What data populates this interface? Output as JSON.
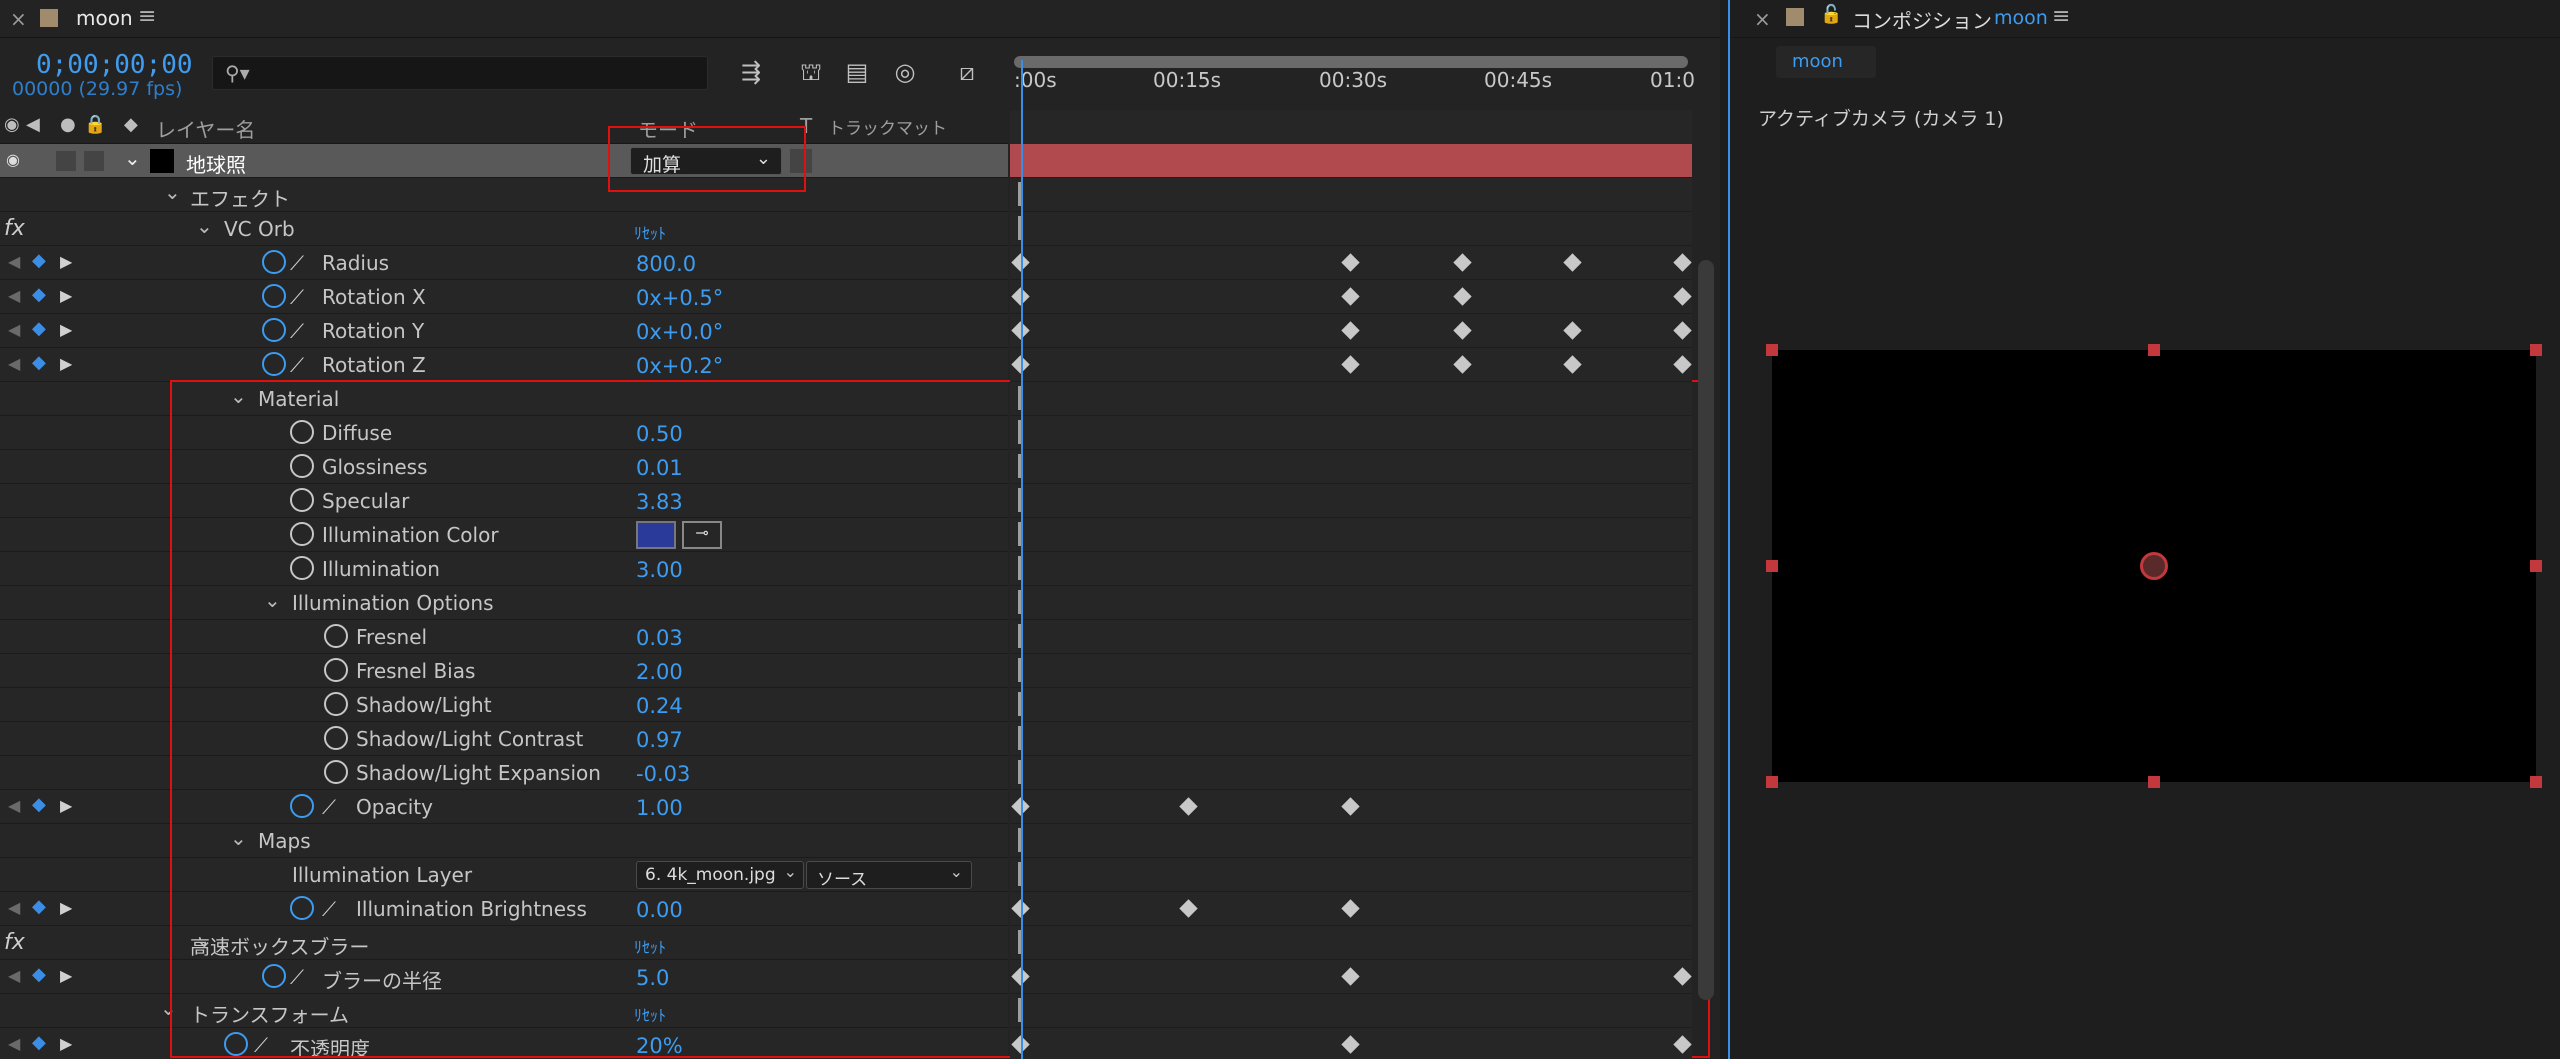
{
  "timeline": {
    "tab_title": "moon",
    "timecode": "0;00;00;00",
    "fps": "00000 (29.97 fps)",
    "search_placeholder": "",
    "columns": {
      "layer_name": "レイヤー名",
      "mode": "モード",
      "t": "T",
      "track_matte": "トラックマット"
    },
    "ruler_ticks": [
      ":00s",
      "00:15s",
      "00:30s",
      "00:45s",
      "01:0"
    ],
    "layer": {
      "name": "地球照",
      "mode": "加算"
    },
    "rows": [
      {
        "label": "エフェクト",
        "value": "",
        "reset": ""
      },
      {
        "label": "VC Orb",
        "value": "",
        "reset": "ﾘｾｯﾄ"
      },
      {
        "label": "Radius",
        "value": "800.0"
      },
      {
        "label": "Rotation X",
        "value": "0x+0.5°"
      },
      {
        "label": "Rotation Y",
        "value": "0x+0.0°"
      },
      {
        "label": "Rotation Z",
        "value": "0x+0.2°"
      },
      {
        "label": "Material",
        "value": ""
      },
      {
        "label": "Diffuse",
        "value": "0.50"
      },
      {
        "label": "Glossiness",
        "value": "0.01"
      },
      {
        "label": "Specular",
        "value": "3.83"
      },
      {
        "label": "Illumination Color",
        "value": ""
      },
      {
        "label": "Illumination",
        "value": "3.00"
      },
      {
        "label": "Illumination Options",
        "value": ""
      },
      {
        "label": "Fresnel",
        "value": "0.03"
      },
      {
        "label": "Fresnel Bias",
        "value": "2.00"
      },
      {
        "label": "Shadow/Light",
        "value": "0.24"
      },
      {
        "label": "Shadow/Light Contrast",
        "value": "0.97"
      },
      {
        "label": "Shadow/Light Expansion",
        "value": "-0.03"
      },
      {
        "label": "Opacity",
        "value": "1.00"
      },
      {
        "label": "Maps",
        "value": ""
      },
      {
        "label": "Illumination Layer",
        "value": ""
      },
      {
        "label": "Illumination Brightness",
        "value": "0.00"
      },
      {
        "label": "高速ボックスブラー",
        "value": "",
        "reset": "ﾘｾｯﾄ"
      },
      {
        "label": "ブラーの半径",
        "value": "5.0"
      },
      {
        "label": "トランスフォーム",
        "value": "",
        "reset": "ﾘｾｯﾄ"
      },
      {
        "label": "不透明度",
        "value": "20%"
      }
    ],
    "illumination_layer_select": "6. 4k_moon.jpg",
    "illumination_source_select": "ソース",
    "illumination_color": "#2a3a9a"
  },
  "composition": {
    "tab_label": "コンポジション",
    "tab_name": "moon",
    "subtab": "moon",
    "camera_label": "アクティブカメラ (カメラ 1)"
  },
  "colors": {
    "accent": "#3d9cf0",
    "highlight_box": "#e01010",
    "layer_bar": "#b04a4e"
  }
}
